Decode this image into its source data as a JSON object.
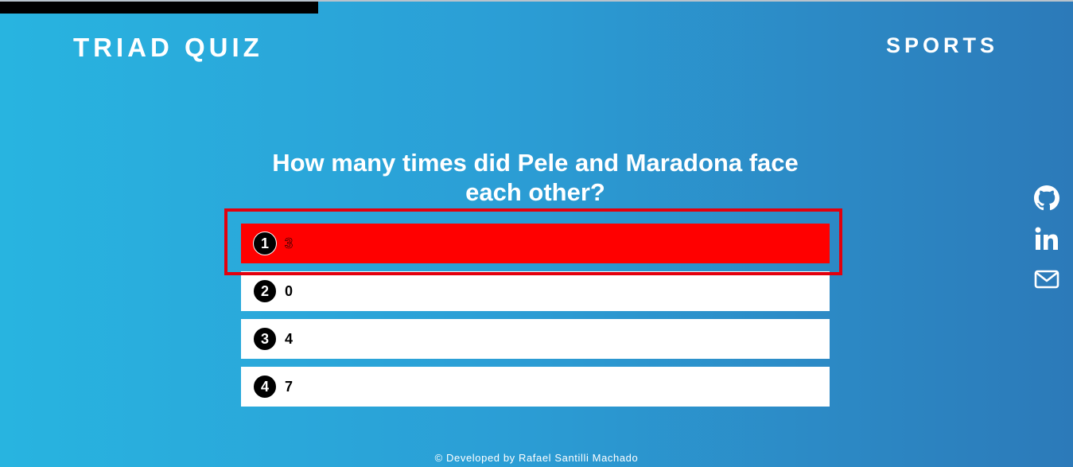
{
  "app": {
    "title": "TRIAD QUIZ",
    "category": "SPORTS"
  },
  "progress": {
    "fraction": 0.2965
  },
  "question": {
    "text": "How many times did Pele and Maradona face each other?"
  },
  "answers": [
    {
      "number": "1",
      "text": "3",
      "selected": true
    },
    {
      "number": "2",
      "text": "0",
      "selected": false
    },
    {
      "number": "3",
      "text": "4",
      "selected": false
    },
    {
      "number": "4",
      "text": "7",
      "selected": false
    }
  ],
  "social": [
    {
      "icon": "github-icon"
    },
    {
      "icon": "linkedin-icon"
    },
    {
      "icon": "mail-icon"
    }
  ],
  "footer": {
    "text": "© Developed by Rafael Santilli Machado"
  },
  "colors": {
    "selected": "#ff0000",
    "highlight": "#e3000d",
    "progress": "#000000"
  }
}
